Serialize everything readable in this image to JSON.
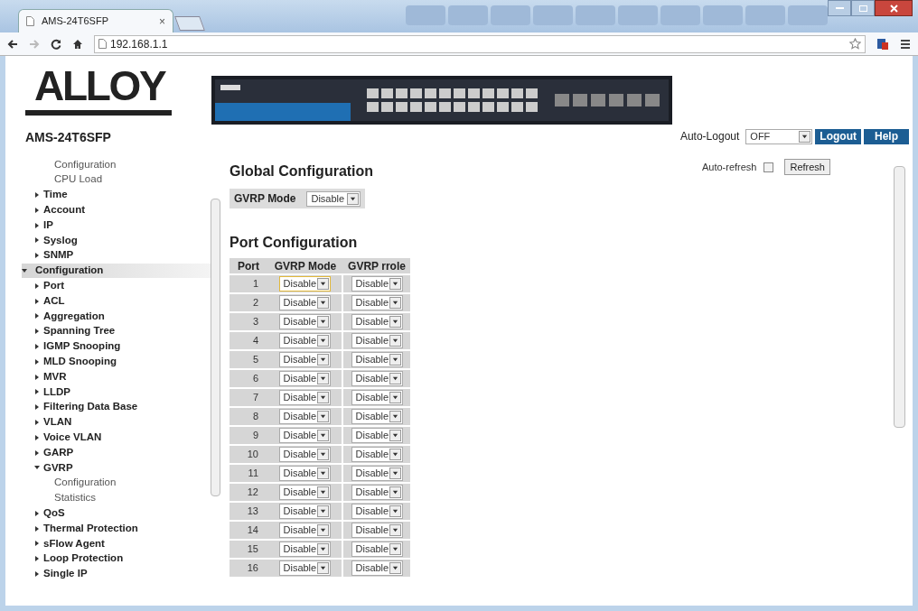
{
  "browser": {
    "tab_title": "AMS-24T6SFP",
    "tab_close": "×",
    "url": "192.168.1.1",
    "back_enabled": true,
    "forward_enabled": false
  },
  "header": {
    "logo": "ALLOY",
    "model": "AMS-24T6SFP",
    "auto_logout_label": "Auto-Logout",
    "auto_logout_value": "OFF",
    "logout_button": "Logout",
    "help_button": "Help"
  },
  "sidebar": {
    "items": [
      {
        "children": [
          {
            "children": [
              {
                "label": "Configuration"
              },
              {
                "label": "CPU Load"
              }
            ]
          },
          {
            "label": "Time",
            "expanded": false
          },
          {
            "label": "Account",
            "expanded": false
          },
          {
            "label": "IP",
            "expanded": false
          },
          {
            "label": "Syslog",
            "expanded": false
          },
          {
            "label": "SNMP",
            "expanded": false
          }
        ]
      },
      {
        "label": "Configuration",
        "expanded": true,
        "selected": true,
        "children": [
          {
            "label": "Port",
            "expanded": false
          },
          {
            "label": "ACL",
            "expanded": false
          },
          {
            "label": "Aggregation",
            "expanded": false
          },
          {
            "label": "Spanning Tree",
            "expanded": false
          },
          {
            "label": "IGMP Snooping",
            "expanded": false
          },
          {
            "label": "MLD Snooping",
            "expanded": false
          },
          {
            "label": "MVR",
            "expanded": false
          },
          {
            "label": "LLDP",
            "expanded": false
          },
          {
            "label": "Filtering Data Base",
            "expanded": false
          },
          {
            "label": "VLAN",
            "expanded": false
          },
          {
            "label": "Voice VLAN",
            "expanded": false
          },
          {
            "label": "GARP",
            "expanded": false
          },
          {
            "label": "GVRP",
            "expanded": true,
            "children": [
              {
                "label": "Configuration"
              },
              {
                "label": "Statistics"
              }
            ]
          },
          {
            "label": "QoS",
            "expanded": false
          },
          {
            "label": "Thermal Protection",
            "expanded": false
          },
          {
            "label": "sFlow Agent",
            "expanded": false
          },
          {
            "label": "Loop Protection",
            "expanded": false
          },
          {
            "label": "Single IP",
            "expanded": false
          }
        ]
      }
    ]
  },
  "main": {
    "auto_refresh_label": "Auto-refresh",
    "auto_refresh_checked": false,
    "refresh_button": "Refresh",
    "global_title": "Global Configuration",
    "gvrp_mode_label": "GVRP Mode",
    "gvrp_mode_value": "Disable",
    "port_title": "Port Configuration",
    "table": {
      "columns": [
        "Port",
        "GVRP Mode",
        "GVRP rrole"
      ],
      "rows": [
        {
          "port": "1",
          "mode": "Disable",
          "role": "Disable",
          "focused": true
        },
        {
          "port": "2",
          "mode": "Disable",
          "role": "Disable",
          "focused": false
        },
        {
          "port": "3",
          "mode": "Disable",
          "role": "Disable",
          "focused": false
        },
        {
          "port": "4",
          "mode": "Disable",
          "role": "Disable",
          "focused": false
        },
        {
          "port": "5",
          "mode": "Disable",
          "role": "Disable",
          "focused": false
        },
        {
          "port": "6",
          "mode": "Disable",
          "role": "Disable",
          "focused": false
        },
        {
          "port": "7",
          "mode": "Disable",
          "role": "Disable",
          "focused": false
        },
        {
          "port": "8",
          "mode": "Disable",
          "role": "Disable",
          "focused": false
        },
        {
          "port": "9",
          "mode": "Disable",
          "role": "Disable",
          "focused": false
        },
        {
          "port": "10",
          "mode": "Disable",
          "role": "Disable",
          "focused": false
        },
        {
          "port": "11",
          "mode": "Disable",
          "role": "Disable",
          "focused": false
        },
        {
          "port": "12",
          "mode": "Disable",
          "role": "Disable",
          "focused": false
        },
        {
          "port": "13",
          "mode": "Disable",
          "role": "Disable",
          "focused": false
        },
        {
          "port": "14",
          "mode": "Disable",
          "role": "Disable",
          "focused": false
        },
        {
          "port": "15",
          "mode": "Disable",
          "role": "Disable",
          "focused": false
        },
        {
          "port": "16",
          "mode": "Disable",
          "role": "Disable",
          "focused": false
        }
      ]
    }
  }
}
